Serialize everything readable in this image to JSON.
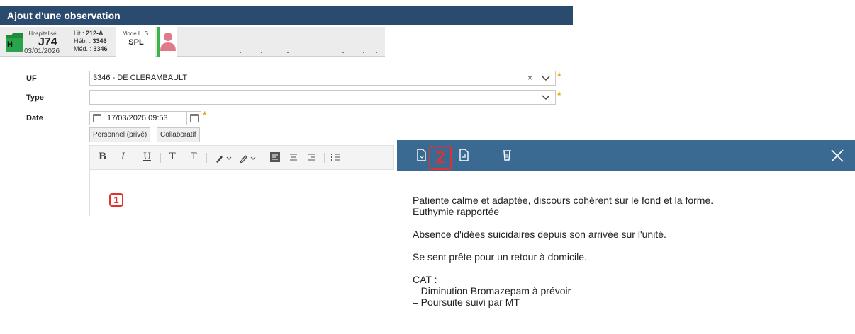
{
  "window": {
    "title": "Ajout d'une observation"
  },
  "patient": {
    "status": "Hospitalisé",
    "folder_letter": "H",
    "day": "J74",
    "admit_date": "03/01/2026",
    "bed_label": "Lit :",
    "bed_value": "212-A",
    "heb_label": "Héb. :",
    "heb_value": "3346",
    "med_label": "Méd. :",
    "med_value": "3346",
    "mode_label": "Mode L. S.",
    "mode_value": "SPL",
    "status_color": "#3bb54a",
    "avatar_color": "#e07a88"
  },
  "form": {
    "uf_label": "UF",
    "uf_value": "3346 - DE CLERAMBAULT",
    "type_label": "Type",
    "type_value": "",
    "date_label": "Date",
    "date_value": "17/03/2026 09:53",
    "required_mark": "*",
    "toggle_private": "Personnel (privé)",
    "toggle_collab": "Collaboratif"
  },
  "toolbar": {
    "bold": "B",
    "italic": "I",
    "underline": "U",
    "superscript": "T",
    "subscript": "T"
  },
  "callouts": {
    "one": "1",
    "two": "2"
  },
  "note": {
    "lines": [
      "Patiente calme et adaptée, discours cohérent sur le fond et la forme.",
      "Euthymie rapportée",
      "Absence d'idées suicidaires depuis son arrivée sur l'unité.",
      "Se sent prête pour un retour à domicile.",
      "CAT :",
      "– Diminution Bromazepam à prévoir",
      "– Poursuite suivi par MT"
    ]
  },
  "colors": {
    "title_bar": "#2a4a6e",
    "note_bar": "#3a6a92",
    "required": "#f0a000",
    "callout": "#e03030"
  }
}
